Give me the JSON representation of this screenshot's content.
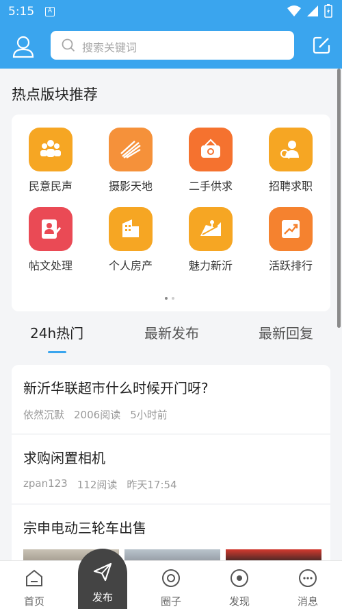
{
  "status_bar": {
    "time": "5:15",
    "app_icon_letter": "A"
  },
  "header": {
    "search_placeholder": "搜索关键词"
  },
  "hot_section": {
    "title": "热点版块推荐",
    "items": [
      {
        "label": "民意民声",
        "icon": "people-icon",
        "color": "#f6a623"
      },
      {
        "label": "摄影天地",
        "icon": "camera-icon",
        "color": "#f5913a"
      },
      {
        "label": "二手供求",
        "icon": "basket-icon",
        "color": "#f5722f"
      },
      {
        "label": "招聘求职",
        "icon": "job-icon",
        "color": "#f6a623"
      },
      {
        "label": "帖文处理",
        "icon": "post-edit-icon",
        "color": "#ea4a55"
      },
      {
        "label": "个人房产",
        "icon": "building-icon",
        "color": "#f6a623"
      },
      {
        "label": "魅力新沂",
        "icon": "map-icon",
        "color": "#f6a623"
      },
      {
        "label": "活跃排行",
        "icon": "chart-icon",
        "color": "#f5822f"
      }
    ]
  },
  "tabs": [
    {
      "label": "24h热门",
      "active": true
    },
    {
      "label": "最新发布",
      "active": false
    },
    {
      "label": "最新回复",
      "active": false
    }
  ],
  "posts": [
    {
      "title": "新沂华联超市什么时候开门呀?",
      "author": "依然沉默",
      "reads": "2006阅读",
      "time": "5小时前"
    },
    {
      "title": "求购闲置相机",
      "author": "zpan123",
      "reads": "112阅读",
      "time": "昨天17:54"
    },
    {
      "title": "宗申电动三轮车出售",
      "author": "",
      "reads": "",
      "time": ""
    }
  ],
  "bottom_nav": {
    "home": "首页",
    "publish": "发布",
    "circle": "圈子",
    "discover": "发现",
    "messages": "消息"
  },
  "colors": {
    "brand": "#3aa5ee",
    "active_tab_underline": "#3aa5ee"
  }
}
